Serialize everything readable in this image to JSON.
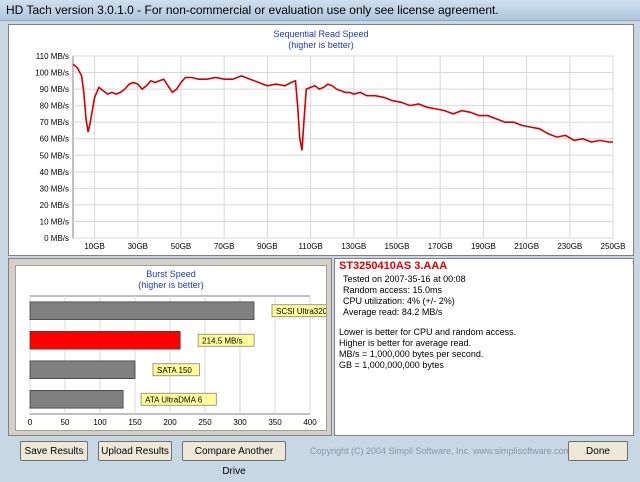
{
  "window": {
    "title": "HD Tach version 3.0.1.0 - For non-commercial or evaluation use only see license agreement."
  },
  "sequential": {
    "title": "Sequential Read Speed",
    "subtitle": "(higher is better)"
  },
  "burst": {
    "title": "Burst Speed",
    "subtitle": "(higher is better)"
  },
  "chart_data": [
    {
      "type": "line",
      "title": "Sequential Read Speed",
      "subtitle": "(higher is better)",
      "ylim": [
        0,
        110
      ],
      "xlim": [
        0,
        250
      ],
      "y_ticks": [
        "0 MB/s",
        "10 MB/s",
        "20 MB/s",
        "30 MB/s",
        "40 MB/s",
        "50 MB/s",
        "60 MB/s",
        "70 MB/s",
        "80 MB/s",
        "90 MB/s",
        "100 MB/s",
        "110 MB/s"
      ],
      "x_ticks": [
        "10GB",
        "30GB",
        "50GB",
        "70GB",
        "90GB",
        "110GB",
        "130GB",
        "150GB",
        "170GB",
        "190GB",
        "210GB",
        "230GB",
        "250GB"
      ],
      "color": "#d40000",
      "grid": true,
      "series": [
        {
          "x": [
            0,
            2,
            4,
            5,
            6,
            7,
            8,
            10,
            12,
            14,
            16,
            18,
            20,
            22,
            24,
            26,
            28,
            30,
            32,
            34,
            36,
            38,
            40,
            42,
            44,
            46,
            48,
            50,
            52,
            55,
            58,
            62,
            66,
            70,
            74,
            78,
            82,
            86,
            90,
            94,
            98,
            101,
            103,
            104,
            105,
            106,
            107,
            108,
            110,
            112,
            114,
            116,
            118,
            120,
            122,
            124,
            126,
            128,
            130,
            133,
            136,
            140,
            144,
            148,
            152,
            156,
            160,
            164,
            168,
            172,
            176,
            180,
            184,
            188,
            192,
            196,
            200,
            204,
            208,
            212,
            216,
            220,
            224,
            228,
            232,
            236,
            240,
            244,
            248,
            250
          ],
          "y": [
            105,
            103,
            98,
            88,
            72,
            64,
            70,
            85,
            91,
            89,
            87,
            88,
            87,
            88,
            90,
            93,
            94,
            93,
            90,
            92,
            95,
            94,
            95,
            96,
            92,
            88,
            90,
            94,
            97,
            97,
            96,
            96,
            97,
            96,
            96,
            98,
            96,
            94,
            92,
            93,
            92,
            94,
            95,
            80,
            60,
            53,
            72,
            90,
            91,
            92,
            90,
            91,
            93,
            92,
            90,
            89,
            88,
            88,
            87,
            88,
            86,
            86,
            85,
            83,
            82,
            80,
            81,
            79,
            78,
            77,
            75,
            77,
            76,
            74,
            74,
            72,
            70,
            70,
            68,
            67,
            66,
            63,
            61,
            62,
            59,
            60,
            58,
            59,
            58,
            58
          ]
        }
      ]
    },
    {
      "type": "bar",
      "title": "Burst Speed",
      "subtitle": "(higher is better)",
      "xlim": [
        0,
        400
      ],
      "x_ticks": [
        "0",
        "50",
        "100",
        "150",
        "200",
        "250",
        "300",
        "350",
        "400"
      ],
      "grid": true,
      "categories": [
        "SCSI Ultra320",
        "214.5 MB/s",
        "SATA 150",
        "ATA UltraDMA 6"
      ],
      "values": [
        320,
        214.5,
        150,
        133
      ],
      "colors": [
        "#808080",
        "#ff0000",
        "#808080",
        "#808080"
      ]
    }
  ],
  "info": {
    "drive": "ST3250410AS 3.AAA",
    "lines": [
      "Tested on 2007-35-16 at 00:08",
      "Random access: 15.0ms",
      "CPU utilization: 4% (+/- 2%)",
      "Average read: 84.2 MB/s"
    ],
    "notes": [
      "Lower is better for CPU and random access.",
      "Higher is better for average read.",
      "MB/s = 1,000,000 bytes per second.",
      "GB = 1,000,000,000 bytes"
    ]
  },
  "buttons": {
    "save": "Save Results",
    "upload": "Upload Results",
    "compare": "Compare Another Drive",
    "done": "Done"
  },
  "footer": {
    "copyright": "Copyright (C) 2004 Simpli Software, Inc. www.simplisoftware.com"
  }
}
